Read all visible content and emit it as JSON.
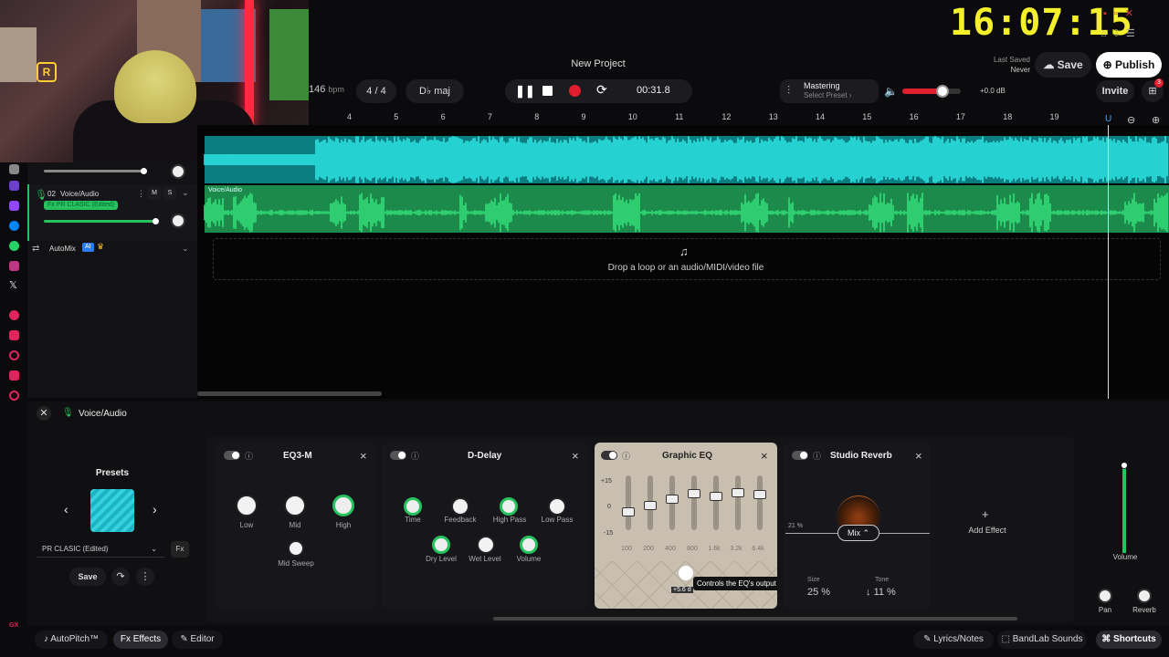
{
  "clock": "16:07:15",
  "project": {
    "title": "New Project",
    "last_saved_label": "Last Saved",
    "last_saved_value": "Never"
  },
  "header": {
    "save": "Save",
    "publish": "Publish",
    "invite": "Invite",
    "notif_count": "3"
  },
  "transport": {
    "bpm": "146",
    "bpm_unit": "bpm",
    "signature": "4 / 4",
    "key": "D♭ maj",
    "time": "00:31.8"
  },
  "mastering": {
    "title": "Mastering",
    "subtitle": "Select Preset ›"
  },
  "master_volume": {
    "label": "+0.0 dB",
    "level": 0.68
  },
  "ruler": [
    "4",
    "5",
    "6",
    "7",
    "8",
    "9",
    "10",
    "11",
    "12",
    "13",
    "14",
    "15",
    "16",
    "17",
    "18",
    "19"
  ],
  "tracks": [
    {
      "number": "02",
      "name": "Voice/Audio",
      "fx": "Fx PR CLASIC (Edited)",
      "mute": "M",
      "solo": "S",
      "lane_label": "Voice/Audio"
    }
  ],
  "automix": {
    "label": "AutoMix",
    "badge": "AI"
  },
  "drop_zone": "Drop a loop or an audio/MIDI/video file",
  "fx_panel": {
    "track_name": "Voice/Audio",
    "presets_title": "Presets",
    "preset_name": "PR CLASIC (Edited)",
    "save": "Save",
    "add_effect": "Add Effect",
    "effects": [
      {
        "name": "EQ3-M",
        "knobs": [
          "Low",
          "Mid",
          "High",
          "Mid Sweep"
        ]
      },
      {
        "name": "D-Delay",
        "knobs": [
          "Time",
          "Feedback",
          "High Pass",
          "Low Pass",
          "Dry Level",
          "Wet Level",
          "Volume"
        ]
      },
      {
        "name": "Graphic EQ",
        "scale": [
          "+15",
          "0",
          "-15"
        ],
        "bands": [
          "100",
          "200",
          "400",
          "800",
          "1.6k",
          "3.2k",
          "6.4k"
        ],
        "output_value": "+5.6 d",
        "tooltip": "Controls the EQ's output level."
      },
      {
        "name": "Studio Reverb",
        "mix_percent": "21 %",
        "mix_label": "Mix",
        "size_label": "Size",
        "size_value": "25 %",
        "tone_label": "Tone",
        "tone_value": "11 %"
      }
    ],
    "right": {
      "volume": "Volume",
      "pan": "Pan",
      "reverb": "Reverb"
    }
  },
  "bottom_tabs": {
    "autopitch": "AutoPitch™",
    "effects": "Effects",
    "editor": "Editor",
    "lyrics": "Lyrics/Notes",
    "sounds": "BandLab Sounds",
    "shortcuts": "Shortcuts"
  }
}
